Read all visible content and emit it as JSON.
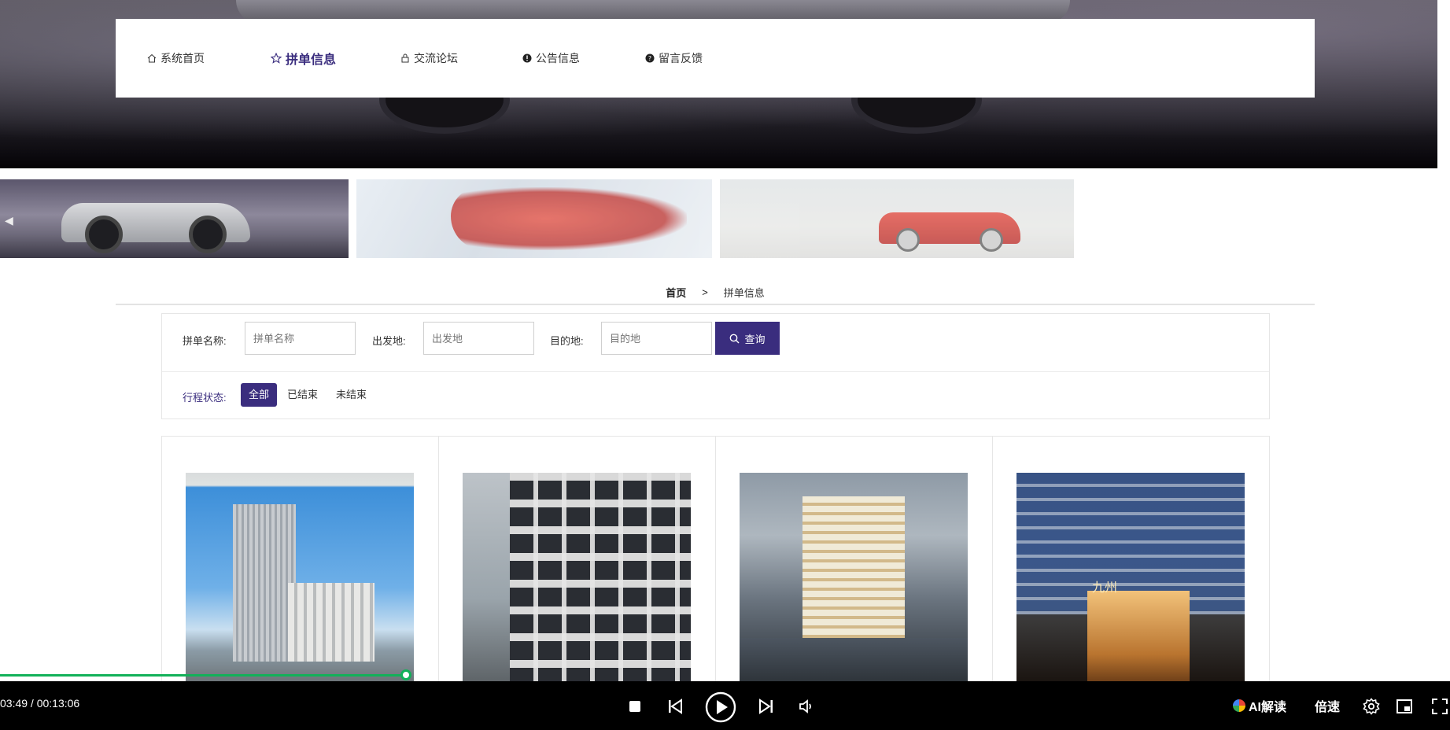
{
  "nav": {
    "items": [
      {
        "label": "系统首页",
        "icon": "home-icon",
        "active": false
      },
      {
        "label": "拼单信息",
        "icon": "star-icon",
        "active": true
      },
      {
        "label": "交流论坛",
        "icon": "lock-icon",
        "active": false
      },
      {
        "label": "公告信息",
        "icon": "info-icon",
        "active": false
      },
      {
        "label": "留言反馈",
        "icon": "question-icon",
        "active": false
      }
    ]
  },
  "breadcrumb": {
    "home": "首页",
    "separator": ">",
    "current": "拼单信息"
  },
  "filter": {
    "name_label": "拼单名称:",
    "name_placeholder": "拼单名称",
    "from_label": "出发地:",
    "from_placeholder": "出发地",
    "to_label": "目的地:",
    "to_placeholder": "目的地",
    "query_label": "查询",
    "status_label": "行程状态:",
    "status_options": [
      "全部",
      "已结束",
      "未结束"
    ],
    "status_selected": "全部"
  },
  "grid": {
    "cards": [
      {
        "icon": "building-photo"
      },
      {
        "icon": "building-photo"
      },
      {
        "icon": "building-photo"
      },
      {
        "icon": "building-photo"
      }
    ],
    "card4_sign": "九州"
  },
  "player": {
    "time": "03:49 / 00:13:06",
    "progress_fraction": 0.28,
    "ai_label": "AI解读",
    "speed_label": "倍速"
  },
  "colors": {
    "accent": "#3a2d7e",
    "progress": "#12b159",
    "player_bg": "#000000"
  }
}
